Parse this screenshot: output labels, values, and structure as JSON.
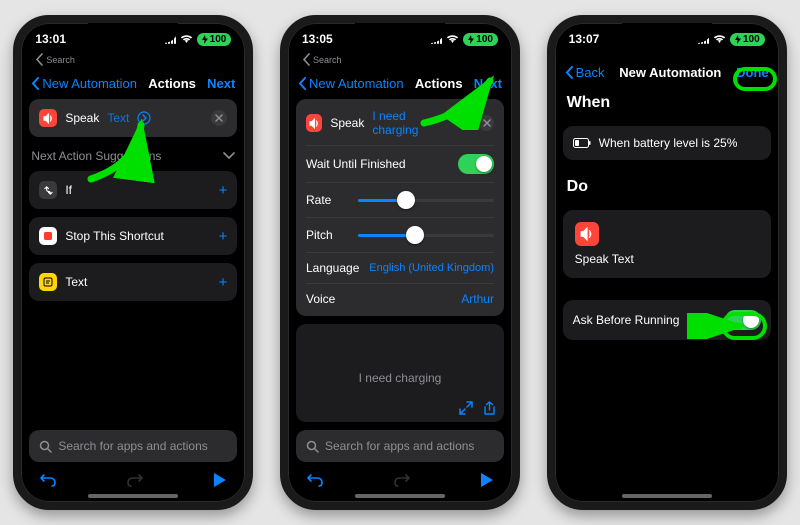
{
  "phones": [
    {
      "status": {
        "time": "13:01",
        "back_search": "Search",
        "battery": "100"
      },
      "nav": {
        "back": "New Automation",
        "title": "Actions",
        "right": "Next"
      },
      "speak": {
        "label": "Speak",
        "placeholder": "Text"
      },
      "suggestions_header": "Next Action Suggestions",
      "suggestions": [
        {
          "icon": "if",
          "label": "If"
        },
        {
          "icon": "stop",
          "label": "Stop This Shortcut"
        },
        {
          "icon": "text",
          "label": "Text"
        }
      ],
      "search_placeholder": "Search for apps and actions"
    },
    {
      "status": {
        "time": "13:05",
        "back_search": "Search",
        "battery": "100"
      },
      "nav": {
        "back": "New Automation",
        "title": "Actions",
        "right": "Next"
      },
      "speak": {
        "label": "Speak",
        "text": "I need charging"
      },
      "rows": {
        "wait_label": "Wait Until Finished",
        "rate_label": "Rate",
        "rate_pct": 35,
        "pitch_label": "Pitch",
        "pitch_pct": 42,
        "lang_label": "Language",
        "lang_value": "English (United Kingdom)",
        "voice_label": "Voice",
        "voice_value": "Arthur"
      },
      "preview_text": "I need charging",
      "search_placeholder": "Search for apps and actions"
    },
    {
      "status": {
        "time": "13:07",
        "battery": "100"
      },
      "nav": {
        "back": "Back",
        "title": "New Automation",
        "right": "Done"
      },
      "when_title": "When",
      "when_text": "When battery level is 25%",
      "do_title": "Do",
      "do_action": "Speak Text",
      "ask_label": "Ask Before Running"
    }
  ],
  "icons": {
    "speak": "speak-icon",
    "chevron_right": "chevron-right-icon",
    "chevron_down": "chevron-down-icon",
    "clear": "clear-icon",
    "plus": "plus-icon",
    "expand": "expand-icon",
    "share": "share-icon",
    "undo": "undo-icon",
    "redo": "redo-icon",
    "play": "play-icon",
    "search": "search-icon",
    "battery": "battery-icon",
    "info": "info-icon"
  }
}
